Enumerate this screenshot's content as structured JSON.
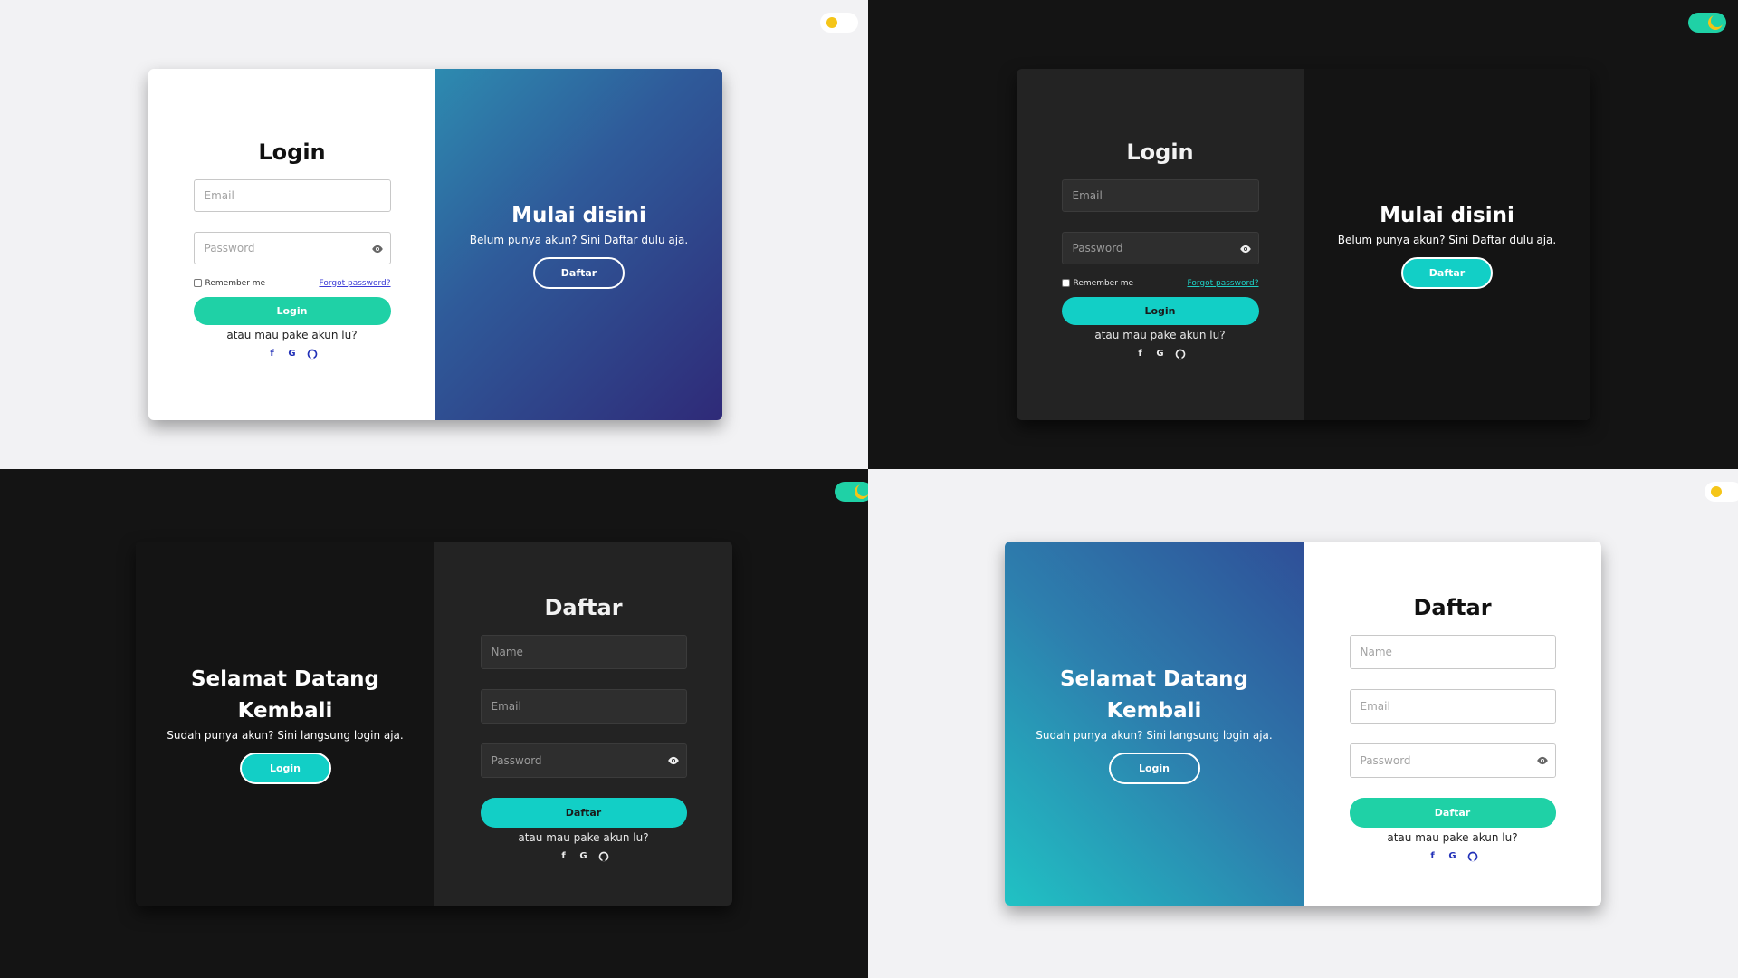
{
  "colors": {
    "accent_green": "#1fd1a6",
    "accent_teal": "#12cfc6",
    "link_light": "#3a3ad6",
    "toggle_sun": "#f5c518"
  },
  "icons": {
    "eye": "eye-icon",
    "facebook": "facebook-icon",
    "google": "google-icon",
    "github": "github-icon",
    "sun": "sun-icon",
    "moon": "moon-icon"
  },
  "login": {
    "title": "Login",
    "email_placeholder": "Email",
    "password_placeholder": "Password",
    "remember_label": "Remember me",
    "forgot_label": "Forgot password?",
    "submit_label": "Login",
    "alt_text": "atau mau pake akun lu?",
    "social": {
      "facebook": "f",
      "google": "G"
    }
  },
  "login_overlay": {
    "title": "Mulai disini",
    "text": "Belum punya akun? Sini Daftar dulu aja.",
    "button_label": "Daftar"
  },
  "register": {
    "title": "Daftar",
    "name_placeholder": "Name",
    "email_placeholder": "Email",
    "password_placeholder": "Password",
    "submit_label": "Daftar",
    "alt_text": "atau mau pake akun lu?",
    "social": {
      "facebook": "f",
      "google": "G"
    }
  },
  "register_overlay": {
    "title_line1": "Selamat Datang",
    "title_line2": "Kembali",
    "text": "Sudah punya akun? Sini langsung login aja.",
    "button_label": "Login"
  }
}
